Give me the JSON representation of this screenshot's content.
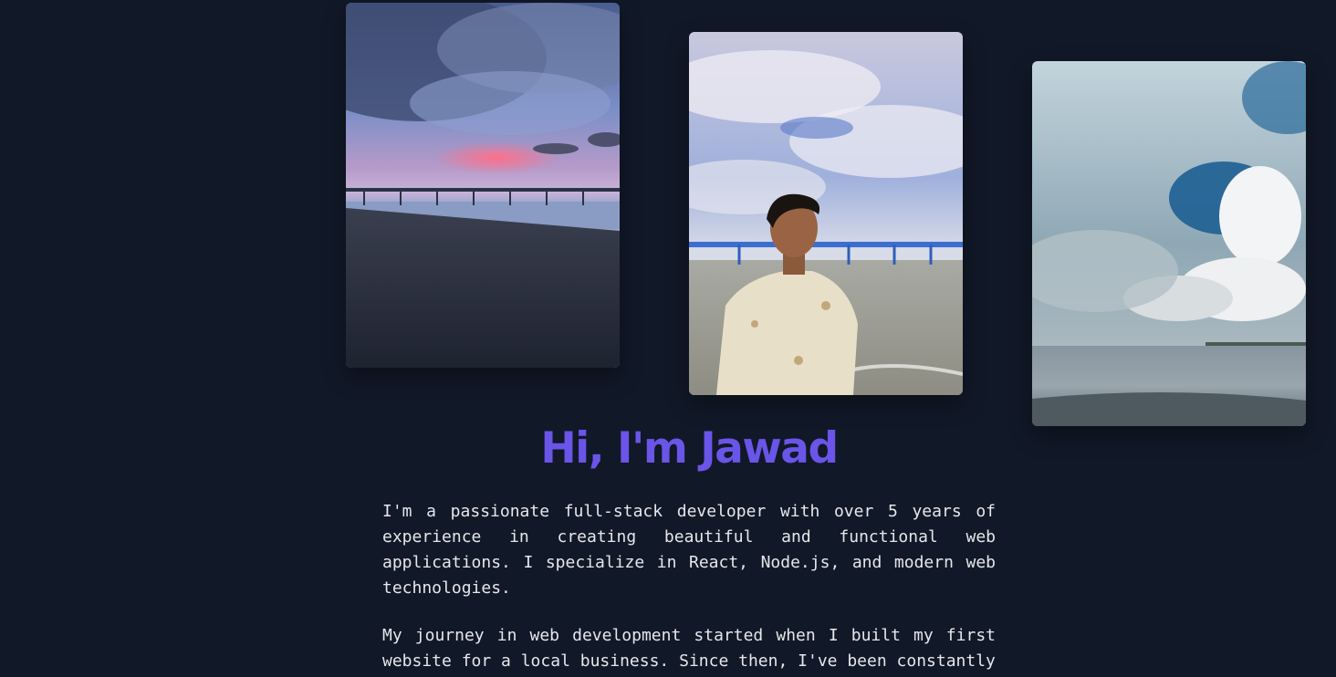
{
  "hero": {
    "photos": [
      {
        "alt": "Sunset over pier and beach"
      },
      {
        "alt": "Portrait on beach with pier"
      },
      {
        "alt": "Clouds over shoreline"
      }
    ],
    "title": "Hi, I'm Jawad",
    "paragraphs": [
      "I'm a passionate full-stack developer with over 5 years of experience in creating beautiful and functional web applications. I specialize in React, Node.js, and modern web technologies.",
      "My journey in web development started when I built my first website for a local business. Since then, I've been constantly"
    ]
  },
  "colors": {
    "background": "#111827",
    "accent": "#6a55e8",
    "text": "#e5e7eb"
  }
}
